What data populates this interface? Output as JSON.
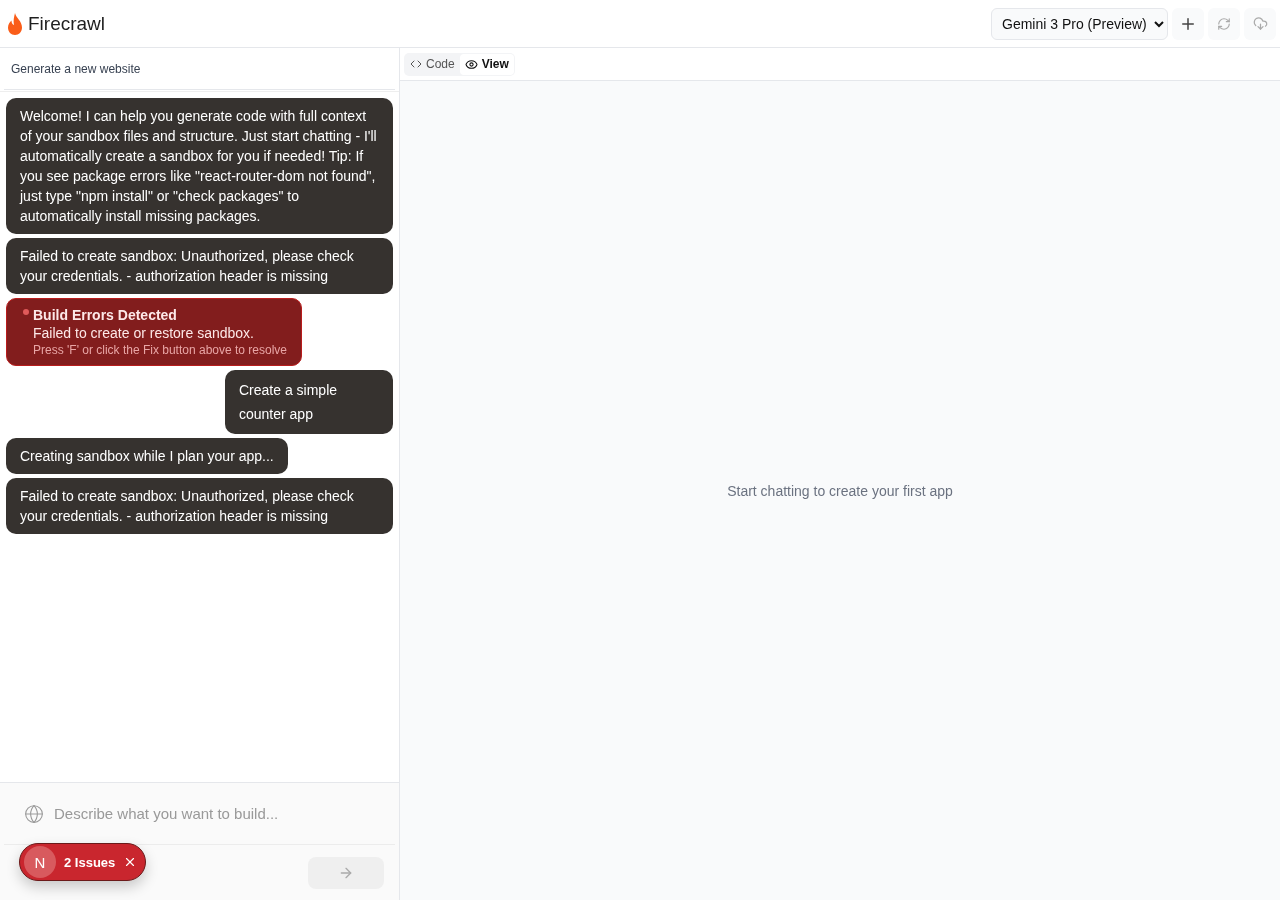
{
  "header": {
    "brand": "Firecrawl",
    "model": "Gemini 3 Pro (Preview)"
  },
  "chat": {
    "title": "Generate a new website",
    "messages": [
      {
        "kind": "assistant",
        "text": "Welcome! I can help you generate code with full context of your sandbox files and structure. Just start chatting - I'll automatically create a sandbox for you if needed! Tip: If you see package errors like \"react-router-dom not found\", just type \"npm install\" or \"check packages\" to automatically install missing packages."
      },
      {
        "kind": "assistant",
        "text": "Failed to create sandbox: Unauthorized, please check your credentials. - authorization header is missing"
      },
      {
        "kind": "error",
        "title": "Build Errors Detected",
        "text": "Failed to create or restore sandbox.",
        "hint": "Press 'F' or click the Fix button above to resolve"
      },
      {
        "kind": "user",
        "text": "Create a simple counter app"
      },
      {
        "kind": "assistant",
        "text": "Creating sandbox while I plan your app..."
      },
      {
        "kind": "assistant",
        "text": "Failed to create sandbox: Unauthorized, please check your credentials. - authorization header is missing"
      }
    ],
    "input": {
      "placeholder": "Describe what you want to build..."
    }
  },
  "tabs": [
    {
      "label": "Code",
      "selected": false
    },
    {
      "label": "View",
      "selected": true
    }
  ],
  "preview": {
    "empty_text": "Start chatting to create your first app"
  },
  "issues": {
    "avatar": "N",
    "label": "2 Issues"
  }
}
